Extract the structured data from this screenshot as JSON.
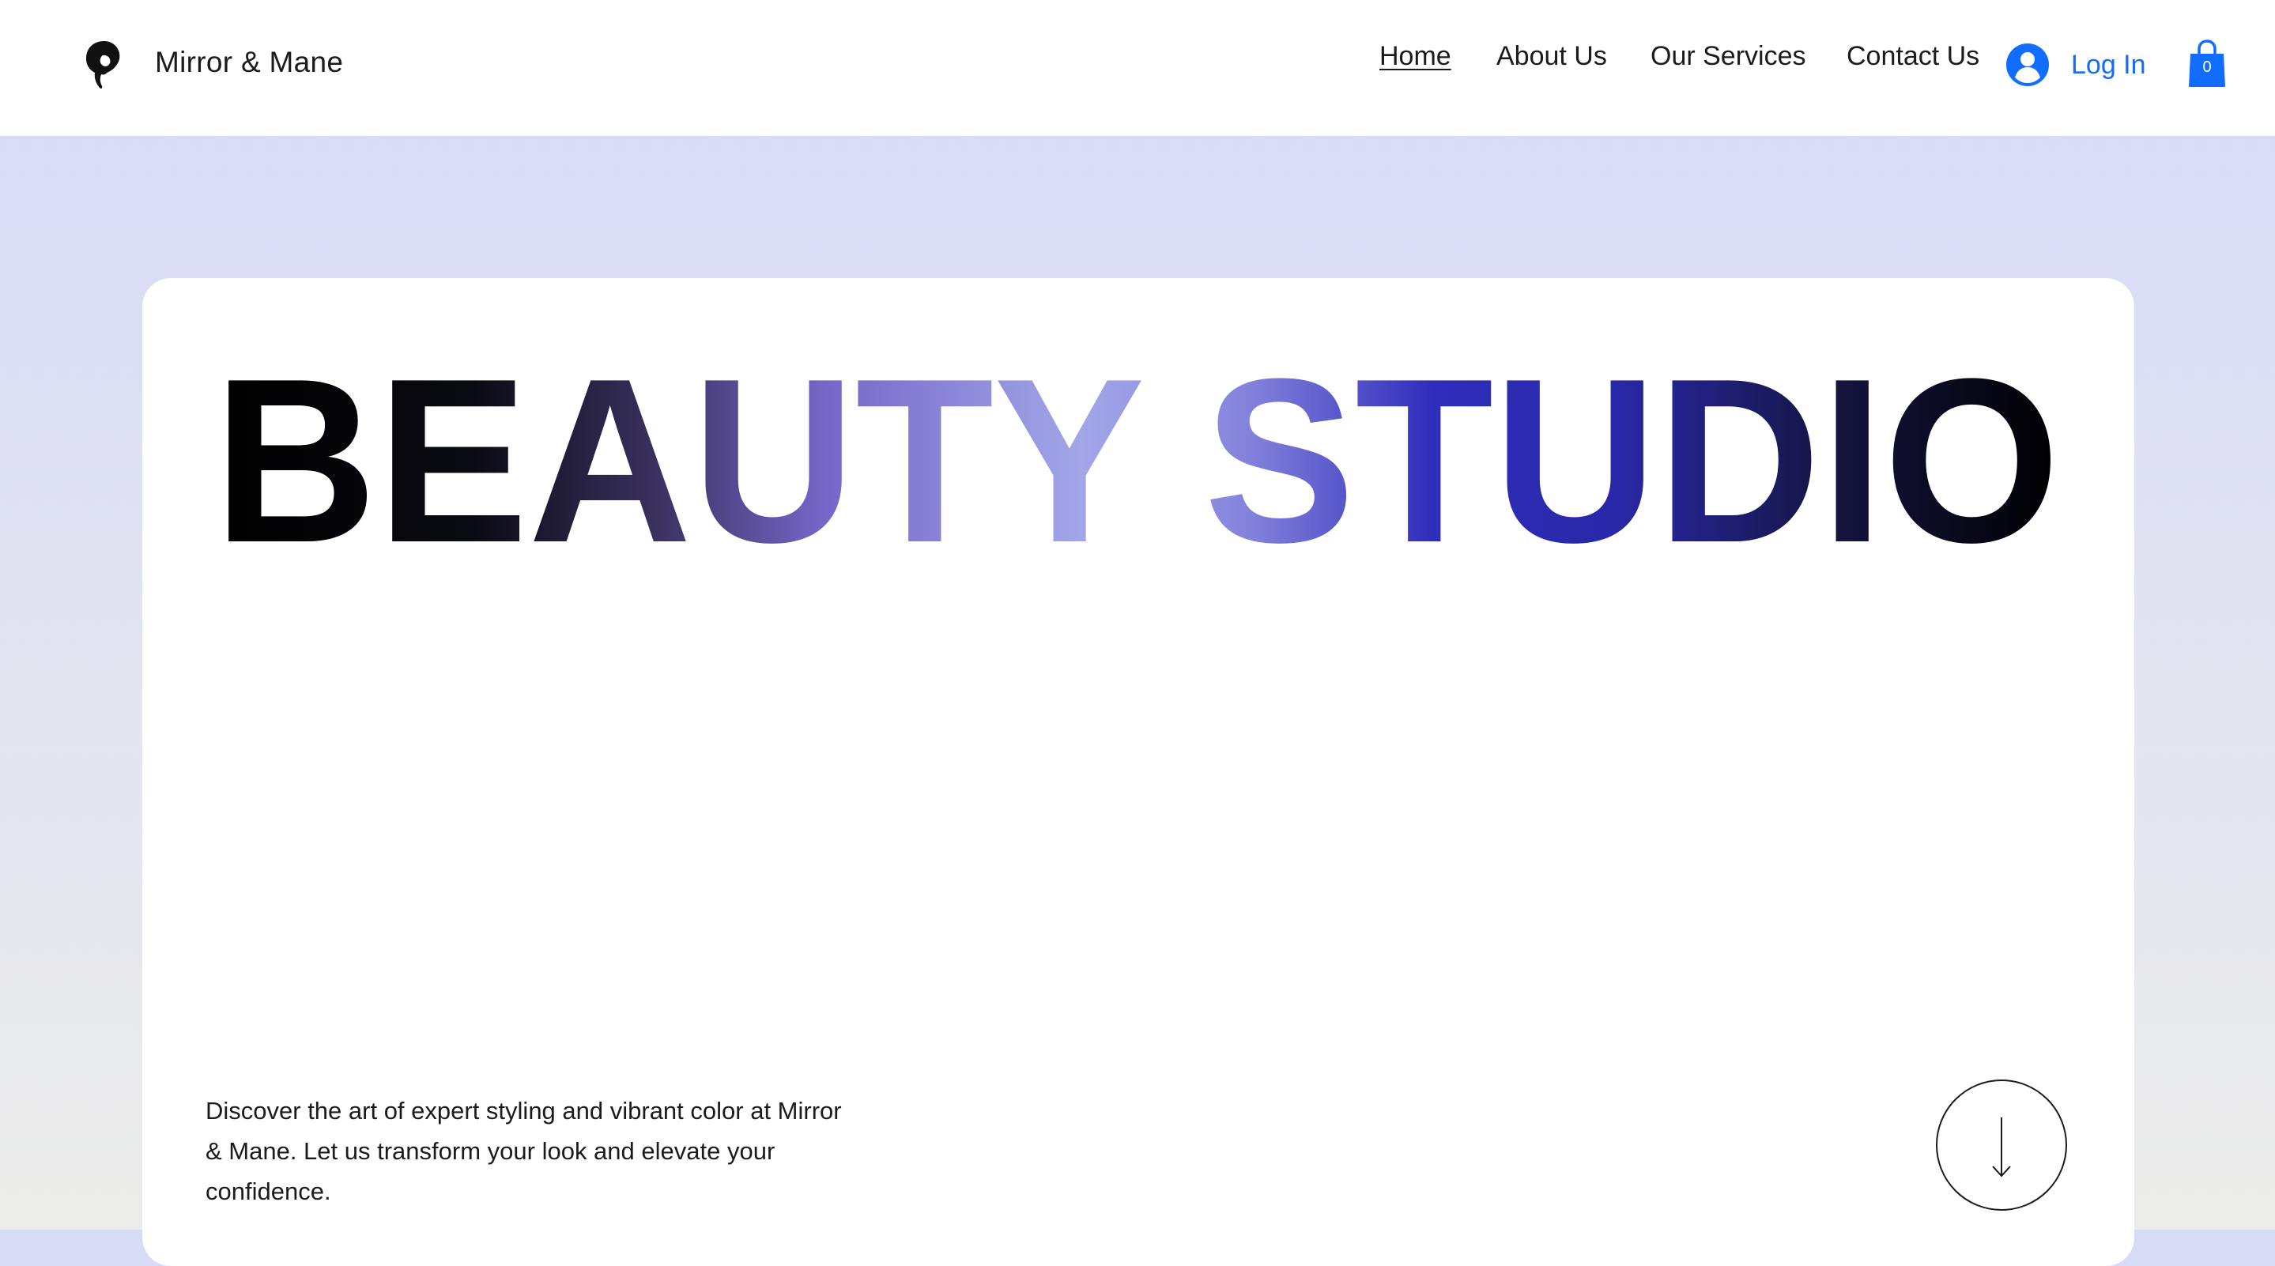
{
  "header": {
    "brand": "Mirror & Mane",
    "logo_icon": "woman-hair-silhouette-icon",
    "nav": [
      {
        "label": "Home",
        "active": true
      },
      {
        "label": "About Us",
        "active": false
      },
      {
        "label": "Our Services",
        "active": false
      },
      {
        "label": "Contact Us",
        "active": false
      }
    ],
    "login_label": "Log In",
    "login_icon": "user-avatar-icon",
    "cart_icon": "shopping-bag-icon",
    "cart_count": "0"
  },
  "hero": {
    "title": "BEAUTY STUDIO",
    "description": "Discover the art of expert styling and vibrant color at Mirror & Mane. Let us transform your look and elevate your confidence.",
    "scroll_icon": "arrow-down-icon"
  },
  "colors": {
    "accent": "#116dff",
    "title_gradient": [
      "#000000",
      "#2b2541",
      "#7566c8",
      "#9ea2e6",
      "#7f80dc",
      "#2d2cba",
      "#1c1c6e",
      "#000000"
    ],
    "background_top": "#d7dbf6",
    "background_bottom": "#ececea",
    "text": "#1b1b1b"
  }
}
